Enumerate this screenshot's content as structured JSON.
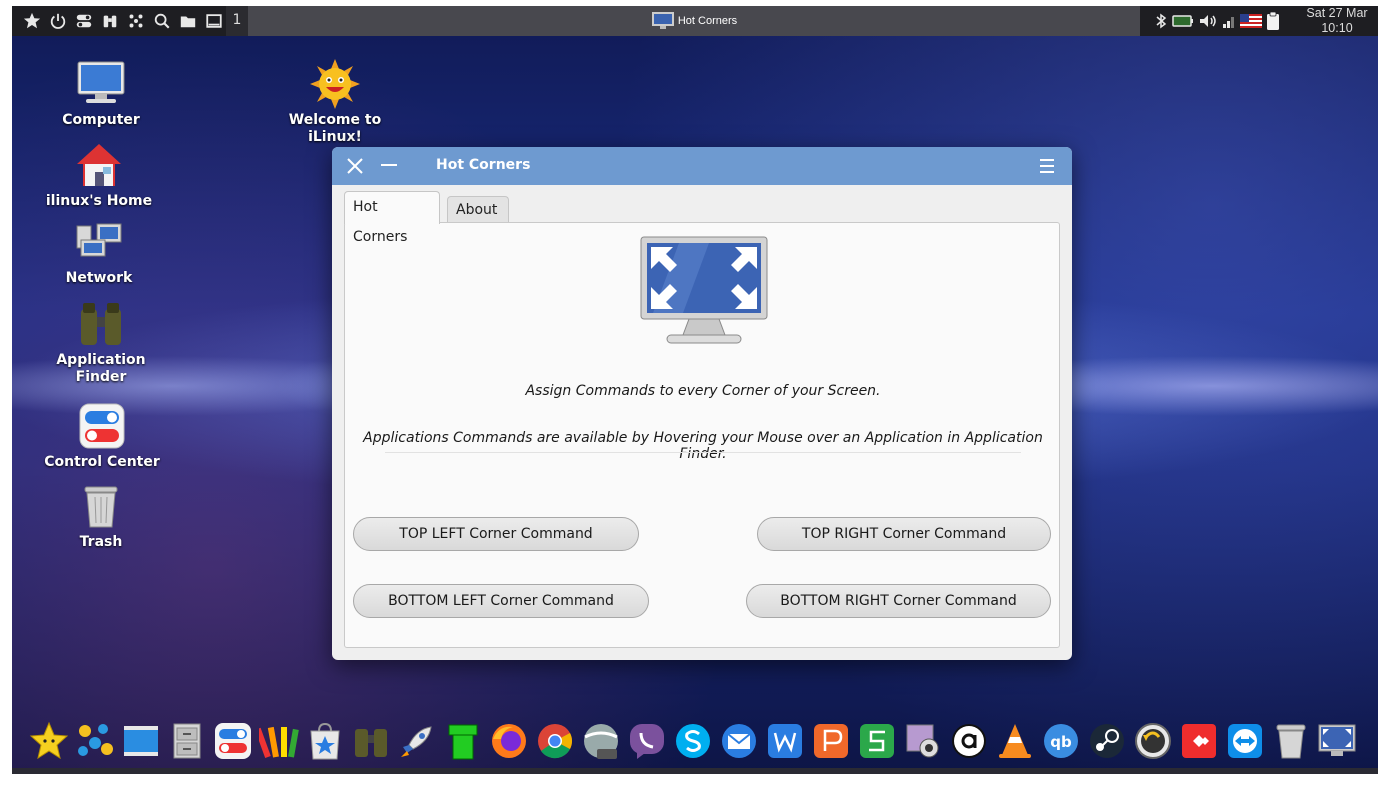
{
  "top_panel": {
    "launchers": [
      "favorites-star-icon",
      "power-icon",
      "toggle-icon",
      "binoculars-icon",
      "grid-dots-icon",
      "search-icon",
      "folder-icon",
      "window-icon"
    ],
    "workspace": "1",
    "active_task": "Hot Corners",
    "tray": [
      "bluetooth-icon",
      "battery-icon",
      "volume-icon",
      "signal-icon",
      "us-flag-icon",
      "clipboard-icon"
    ],
    "clock": {
      "date": "Sat 27 Mar",
      "time": "10:10"
    }
  },
  "desktop_icons": [
    {
      "name": "computer",
      "label": "Computer"
    },
    {
      "name": "home",
      "label": "ilinux's Home"
    },
    {
      "name": "network",
      "label": "Network"
    },
    {
      "name": "app-finder",
      "label": "Application Finder"
    },
    {
      "name": "control-center",
      "label": "Control Center"
    },
    {
      "name": "trash",
      "label": "Trash"
    },
    {
      "name": "welcome",
      "label": "Welcome to iLinux!"
    }
  ],
  "window": {
    "title": "Hot Corners",
    "tabs": [
      {
        "label": "Hot Corners",
        "active": true
      },
      {
        "label": "About",
        "active": false
      }
    ],
    "description_1": "Assign Commands to every Corner of your Screen.",
    "description_2": "Applications Commands are available by Hovering your Mouse over an Application in Application Finder.",
    "buttons": {
      "top_left": "TOP LEFT Corner Command",
      "top_right": "TOP RIGHT Corner Command",
      "bottom_left": "BOTTOM LEFT Corner Command",
      "bottom_right": "BOTTOM RIGHT Corner Command"
    }
  },
  "dock": [
    "favorites-star-icon",
    "app-grid-icon",
    "show-desktop-icon",
    "file-cabinet-icon",
    "control-center-icon",
    "color-palette-icon",
    "app-store-icon",
    "binoculars-icon",
    "rocket-icon",
    "green-pipe-icon",
    "firefox-icon",
    "chrome-icon",
    "google-earth-pro-icon",
    "viber-icon",
    "skype-icon",
    "mail-icon",
    "wps-writer-icon",
    "wps-presentation-icon",
    "wps-spreadsheet-icon",
    "webcam-icon",
    "amazon-icon",
    "vlc-icon",
    "qbittorrent-icon",
    "steam-icon",
    "timeshift-icon",
    "anydesk-icon",
    "teamviewer-icon",
    "trash-icon",
    "hot-corners-icon"
  ]
}
